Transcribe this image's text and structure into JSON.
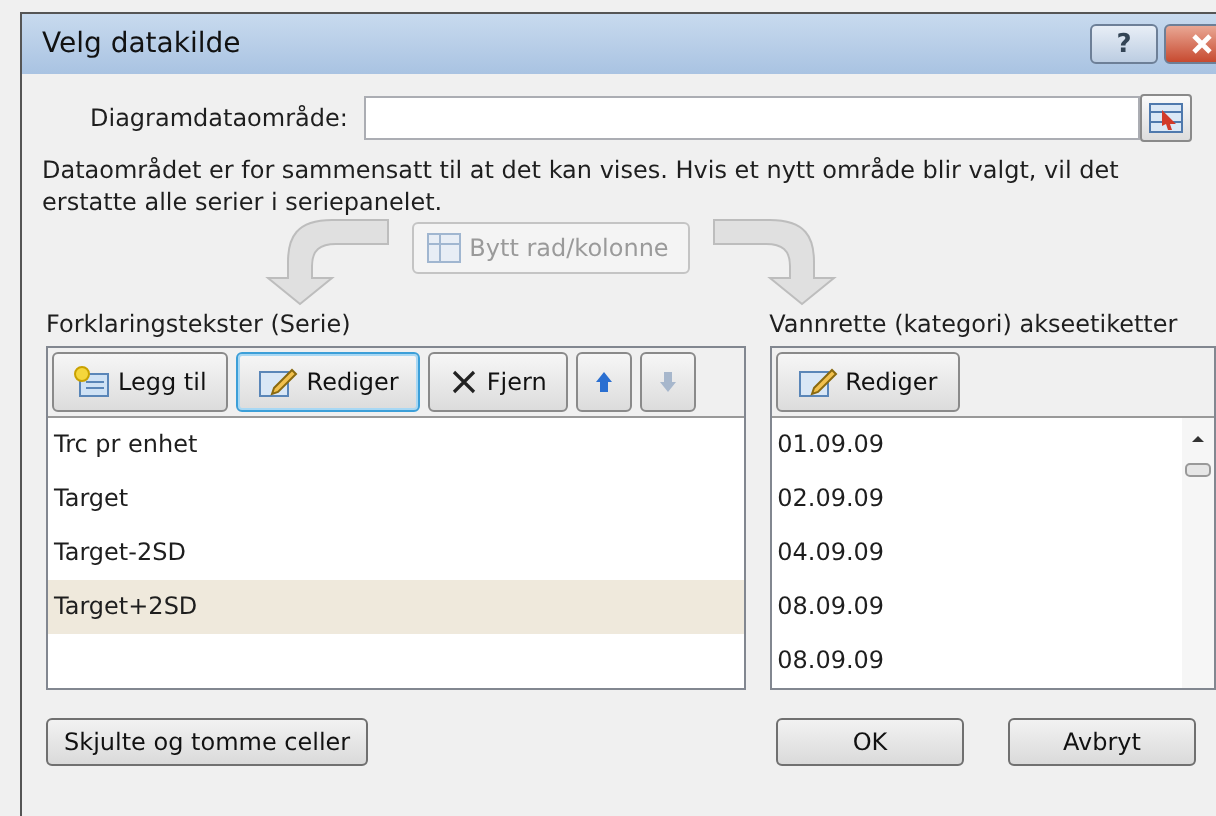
{
  "window": {
    "title": "Velg datakilde",
    "controls": [
      {
        "kind": "help",
        "label": "?"
      },
      {
        "kind": "close"
      }
    ]
  },
  "range": {
    "label": "Diagramdataområde:"
  },
  "message": "Dataområdet er for sammensatt til at det kan vises. Hvis et nytt område blir valgt, vil det erstatte alle serier i seriepanelet.",
  "switch_button": {
    "label": "Bytt rad/kolonne",
    "disabled": true
  },
  "series_panel": {
    "label": "Forklaringstekster (Serie)",
    "toolbar": [
      {
        "kind": "add",
        "label": "Legg til",
        "disabled": false,
        "focused": false
      },
      {
        "kind": "edit",
        "label": "Rediger",
        "disabled": false,
        "focused": true
      },
      {
        "kind": "remove",
        "label": "Fjern",
        "disabled": false,
        "focused": false
      },
      {
        "kind": "up",
        "disabled": false,
        "focused": false
      },
      {
        "kind": "down",
        "disabled": true,
        "focused": false
      }
    ],
    "items": [
      {
        "label": "Trc pr enhet",
        "selected": false
      },
      {
        "label": "Target",
        "selected": false
      },
      {
        "label": "Target-2SD",
        "selected": false
      },
      {
        "label": "Target+2SD",
        "selected": true
      }
    ]
  },
  "category_panel": {
    "label": "Vannrette (kategori) akseetiketter",
    "toolbar": [
      {
        "kind": "edit",
        "label": "Rediger",
        "disabled": false,
        "focused": false
      }
    ],
    "items": [
      {
        "label": "01.09.09",
        "selected": false
      },
      {
        "label": "02.09.09",
        "selected": false
      },
      {
        "label": "04.09.09",
        "selected": false
      },
      {
        "label": "08.09.09",
        "selected": false
      },
      {
        "label": "08.09.09",
        "selected": false
      }
    ]
  },
  "footer": {
    "hidden_cells_button": "Skjulte og tomme celler",
    "buttons": [
      "OK",
      "Avbryt"
    ]
  }
}
